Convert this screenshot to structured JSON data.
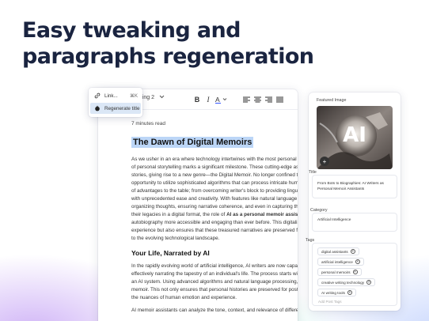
{
  "headline": {
    "line1": "Easy tweaking and",
    "line2": "paragraphs regeneration"
  },
  "context_menu": {
    "items": [
      {
        "label": "Link...",
        "shortcut": "⌘K",
        "icon": "link-icon"
      },
      {
        "label": "Regenerate title",
        "icon": "sparkle-icon",
        "active": true
      }
    ]
  },
  "toolbar": {
    "heading_select": "ading 2",
    "buttons": [
      "bold-icon",
      "italic-icon",
      "text-color-icon",
      "align-left-icon",
      "align-center-icon",
      "align-right-icon",
      "align-justify-icon"
    ]
  },
  "editor": {
    "read_time": "7 minutes read",
    "title": "The Dawn of Digital Memoirs",
    "paragraph1": [
      "As we usher in an era where technology intertwines with the most personal as",
      "of personal storytelling marks a significant milestone. These cutting-edge assis",
      "stories, giving rise to a new genre—the Digital Memoir. No longer confined to t",
      "opportunity to utilize sophisticated algorithms that can process intricate human",
      "of advantages to the table; from overcoming writer's block to providing linguisti",
      "with unprecedented ease and creativity. With features like natural language pro",
      "organizing thoughts, ensuring narrative coherence, and even in capturing the n",
      "their legacies in a digital format, the role of ",
      "autobiography more accessible and engaging than ever before. This digitalizat",
      "experience but also ensures that these treasured narratives are preserved for",
      "to the evolving technological landscape."
    ],
    "paragraph1_bold": "AI as a personal memoir assistan",
    "subheading": "Your Life, Narrated by AI",
    "paragraph2": [
      "In the rapidly evolving world of artificial intelligence, AI writers are now capable",
      "effectively narrating the tapestry of an individual's life. The process starts with",
      "an AI system. Using advanced algorithms and natural language processing, the",
      "memoir. This not only ensures that personal histories are preserved for posterit",
      "the nuances of human emotion and experience."
    ],
    "paragraph3": [
      "AI memoir assistants can analyze the tone, context, and relevance of differe"
    ]
  },
  "panel": {
    "featured_image_label": "Featured Image",
    "image_text": "AI",
    "title_label": "Title",
    "title_value": "From Bots to Biographies: AI Writers as Personal Memoir Assistants",
    "category_label": "Category",
    "category_value": "Artificial Intelligence",
    "tags_label": "Tags",
    "tags": [
      "digital assistants",
      "artificial intelligence",
      "personal memoirs",
      "creative writing technology",
      "AI writing tools"
    ],
    "add_tag_placeholder": "Add Post Tags"
  },
  "colors": {
    "headline": "#1a2440",
    "highlight": "#bcd6f7",
    "menu_active": "#dbe7f6"
  }
}
